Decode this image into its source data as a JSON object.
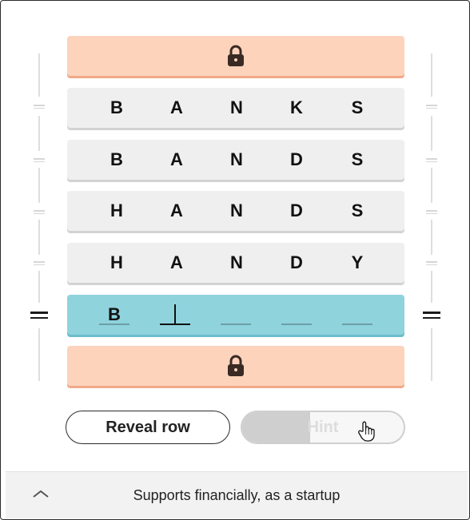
{
  "board": {
    "locked_top_icon": "lock-icon",
    "rows": [
      [
        "B",
        "A",
        "N",
        "K",
        "S"
      ],
      [
        "B",
        "A",
        "N",
        "D",
        "S"
      ],
      [
        "H",
        "A",
        "N",
        "D",
        "S"
      ],
      [
        "H",
        "A",
        "N",
        "D",
        "Y"
      ]
    ],
    "active_row": [
      "B",
      "",
      "",
      "",
      ""
    ],
    "locked_bottom_icon": "lock-icon"
  },
  "controls": {
    "reveal_label": "Reveal row",
    "hint_label": "Hint",
    "hint_progress": 0.42
  },
  "clue_bar": {
    "toggle_icon": "chevron-up-icon",
    "clue_text": "Supports financially, as a startup"
  },
  "colors": {
    "locked_row": "#fdd3bc",
    "word_row": "#efefef",
    "active_row": "#8fd3dd"
  }
}
